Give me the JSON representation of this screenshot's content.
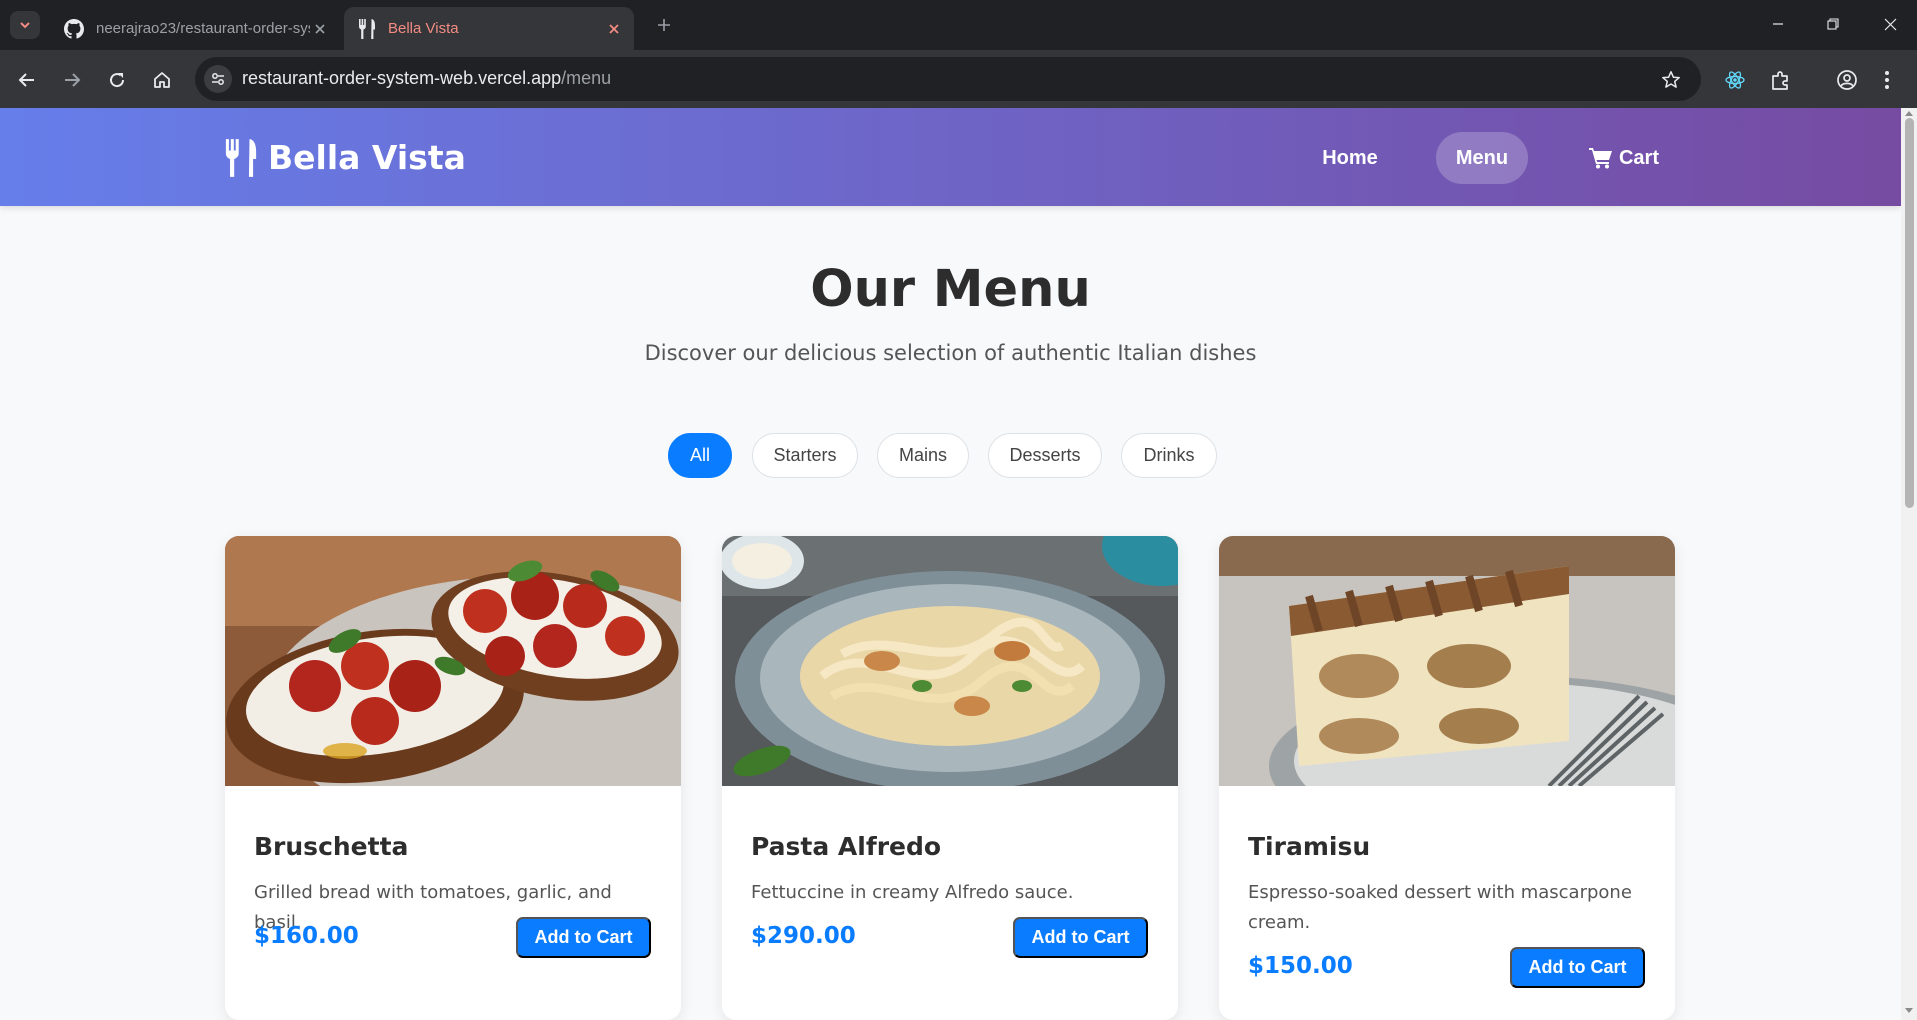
{
  "browser": {
    "tabs": [
      {
        "title": "neerajrao23/restaurant-order-system",
        "icon": "github-icon",
        "active": false
      },
      {
        "title": "Bella Vista",
        "icon": "fork-knife-icon",
        "active": true
      }
    ],
    "url_host": "restaurant-order-system-web.vercel.app",
    "url_path": "/menu"
  },
  "site": {
    "brand": "Bella Vista",
    "brand_icon": "fork-knife-icon",
    "nav": {
      "home": "Home",
      "menu": "Menu",
      "cart": "Cart",
      "active": "Menu"
    },
    "colors": {
      "gradient_start": "#667eea",
      "gradient_end": "#764ba2",
      "accent": "#0a7cff"
    }
  },
  "page": {
    "title": "Our Menu",
    "subtitle": "Discover our delicious selection of authentic Italian dishes"
  },
  "filters": {
    "items": [
      "All",
      "Starters",
      "Mains",
      "Desserts",
      "Drinks"
    ],
    "active": "All"
  },
  "menu": {
    "items": [
      {
        "name": "Bruschetta",
        "description": "Grilled bread with tomatoes, garlic, and basil.",
        "price": "$160.00",
        "button": "Add to Cart"
      },
      {
        "name": "Pasta Alfredo",
        "description": "Fettuccine in creamy Alfredo sauce.",
        "price": "$290.00",
        "button": "Add to Cart"
      },
      {
        "name": "Tiramisu",
        "description": "Espresso-soaked dessert with mascarpone cream.",
        "price": "$150.00",
        "button": "Add to Cart"
      }
    ]
  }
}
